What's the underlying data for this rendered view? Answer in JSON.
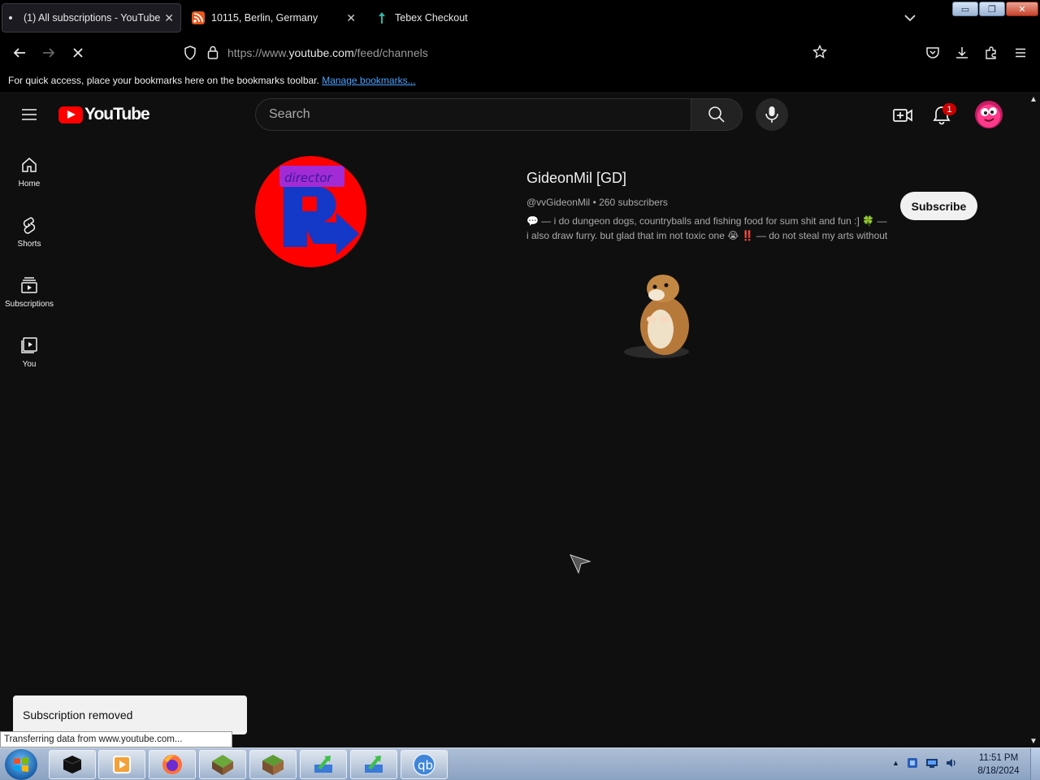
{
  "browser": {
    "tabs": [
      {
        "label": "(1) All subscriptions - YouTube",
        "active": true
      },
      {
        "label": "10115, Berlin, Germany",
        "active": false
      },
      {
        "label": "Tebex Checkout",
        "active": false
      }
    ],
    "url_prefix": "https://www.",
    "url_host": "youtube.com",
    "url_path": "/feed/channels",
    "bookmarks_text": "For quick access, place your bookmarks here on the bookmarks toolbar.",
    "bookmarks_link": "Manage bookmarks...",
    "status_text": "Transferring data from www.youtube.com..."
  },
  "youtube": {
    "logo_text": "YouTube",
    "search_placeholder": "Search",
    "notification_count": "1",
    "guide": [
      {
        "label": "Home",
        "icon": "home-icon"
      },
      {
        "label": "Shorts",
        "icon": "shorts-icon"
      },
      {
        "label": "Subscriptions",
        "icon": "subscriptions-icon"
      },
      {
        "label": "You",
        "icon": "you-icon"
      }
    ],
    "channel": {
      "name": "GideonMil [GD]",
      "handle": "@vvGideonMil",
      "subscribers": "260 subscribers",
      "avatar_text": "director",
      "description": "💬 — i do dungeon dogs, countryballs and fishing food for sum shit and fun :] 🍀 — i also draw furry. but glad that im not toxic one 😭 ‼️ — do not steal my arts without",
      "subscribe_label": "Subscribe"
    },
    "toast": "Subscription removed",
    "colors": {
      "brand_red": "#ff0000",
      "background": "#0f0f0f",
      "link_blue": "#4aa3ff"
    }
  },
  "taskbar": {
    "time": "11:51 PM",
    "date": "8/18/2024",
    "apps": [
      "black-box-icon",
      "media-player-icon",
      "firefox-icon",
      "grass-block-icon",
      "minecraft-icon",
      "green-arrow-app-icon",
      "green-arrow-app-icon-2",
      "qbittorrent-icon"
    ],
    "qb_label": "qb"
  }
}
